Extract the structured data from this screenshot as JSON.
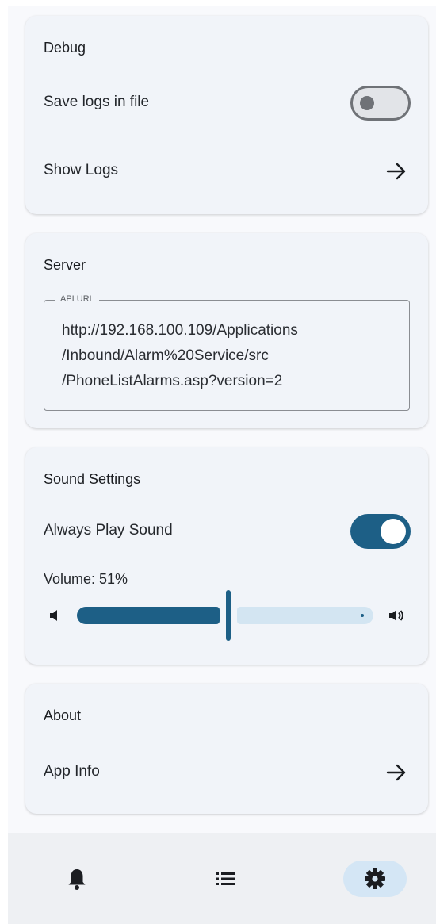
{
  "debug": {
    "title": "Debug",
    "save_logs_label": "Save logs in file",
    "save_logs_enabled": false,
    "show_logs_label": "Show Logs",
    "arrow_icon": "arrow-right-icon"
  },
  "server": {
    "title": "Server",
    "api_url_label": "API URL",
    "api_url_value": "http://192.168.100.109/Applications\n/Inbound/Alarm%20Service/src\n/PhoneListAlarms.asp?version=2"
  },
  "sound": {
    "title": "Sound Settings",
    "always_play_label": "Always Play Sound",
    "always_play_enabled": true,
    "volume_label": "Volume: 51%",
    "volume_percent": 51,
    "volume_down_icon": "volume-low-icon",
    "volume_up_icon": "volume-high-icon"
  },
  "about": {
    "title": "About",
    "app_info_label": "App Info"
  },
  "nav": {
    "items": [
      {
        "icon": "bell-icon",
        "active": false
      },
      {
        "icon": "list-icon",
        "active": false
      },
      {
        "icon": "gear-icon",
        "active": true
      }
    ]
  },
  "colors": {
    "accent": "#1d5f86",
    "accent_light": "#d3e5f2",
    "card_bg": "#f1f4f9",
    "nav_active_bg": "#d4e6f5"
  }
}
